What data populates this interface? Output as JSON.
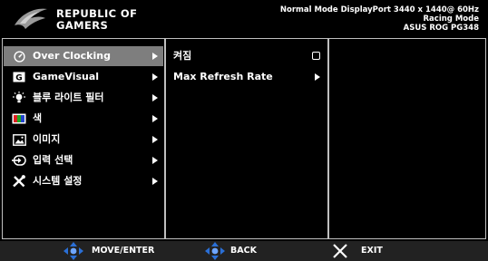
{
  "brand": {
    "line1": "REPUBLIC OF",
    "line2": "GAMERS",
    "logo_icon": "rog-eye-logo-icon"
  },
  "status": {
    "line1": "Normal Mode DisplayPort 3440 x 1440@ 60Hz",
    "line2": "Racing Mode",
    "line3": "ASUS ROG PG348"
  },
  "menu": {
    "items": [
      {
        "label": "Over Clocking",
        "icon": "speedometer-icon",
        "active": true
      },
      {
        "label": "GameVisual",
        "icon": "gamevisual-icon",
        "active": false
      },
      {
        "label": "블루 라이트 필터",
        "icon": "light-bulb-icon",
        "active": false
      },
      {
        "label": "색",
        "icon": "color-icon",
        "active": false
      },
      {
        "label": "이미지",
        "icon": "image-icon",
        "active": false
      },
      {
        "label": "입력 선택",
        "icon": "input-select-icon",
        "active": false
      },
      {
        "label": "시스템 설정",
        "icon": "tools-icon",
        "active": false
      }
    ]
  },
  "submenu": {
    "items": [
      {
        "label": "켜짐",
        "control": "checkbox",
        "checked": false
      },
      {
        "label": "Max Refresh Rate",
        "control": "arrow"
      }
    ]
  },
  "footer": {
    "move_label": "MOVE/ENTER",
    "back_label": "BACK",
    "exit_label": "EXIT"
  },
  "colors": {
    "background": "#000000",
    "active_item": "#7e7e7e",
    "panel_border": "#bfbfbf",
    "nav_blue": "#2a6fd6",
    "footer_bg": "#222222"
  }
}
